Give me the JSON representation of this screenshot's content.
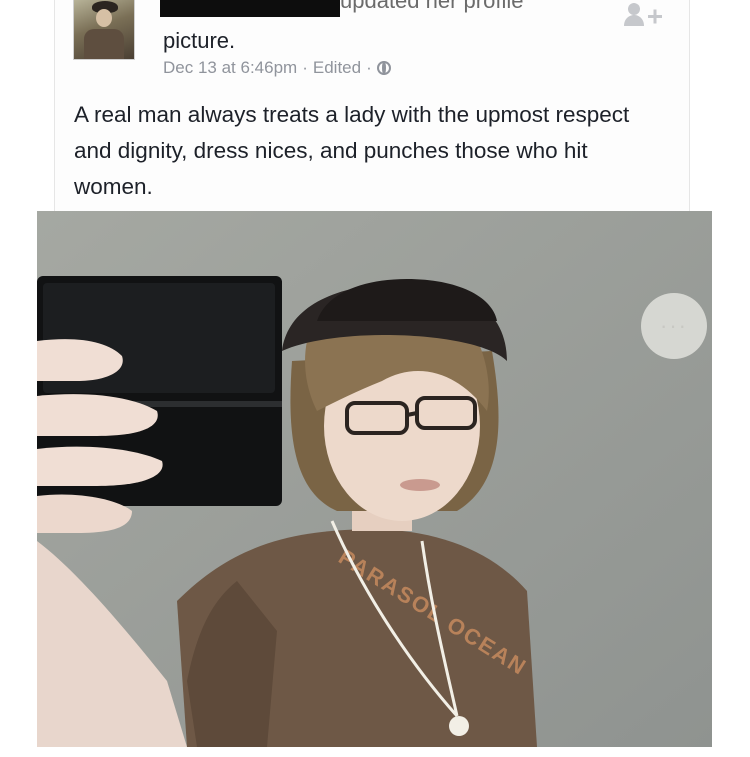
{
  "post": {
    "headline_action": "updated her profile",
    "headline_object": "picture.",
    "timestamp": "Dec 13 at 6:46pm",
    "edited_label": "Edited",
    "separator": "·",
    "privacy_icon": "globe-icon",
    "add_friend_icon": "add-friend-icon",
    "text": "A real man always treats a lady with the upmost respect and dignity, dress nices, and punches those who hit women."
  },
  "photo": {
    "shirt_text": "PARASOL OCEAN",
    "more_icon": "more-options-icon",
    "more_label": "···"
  }
}
